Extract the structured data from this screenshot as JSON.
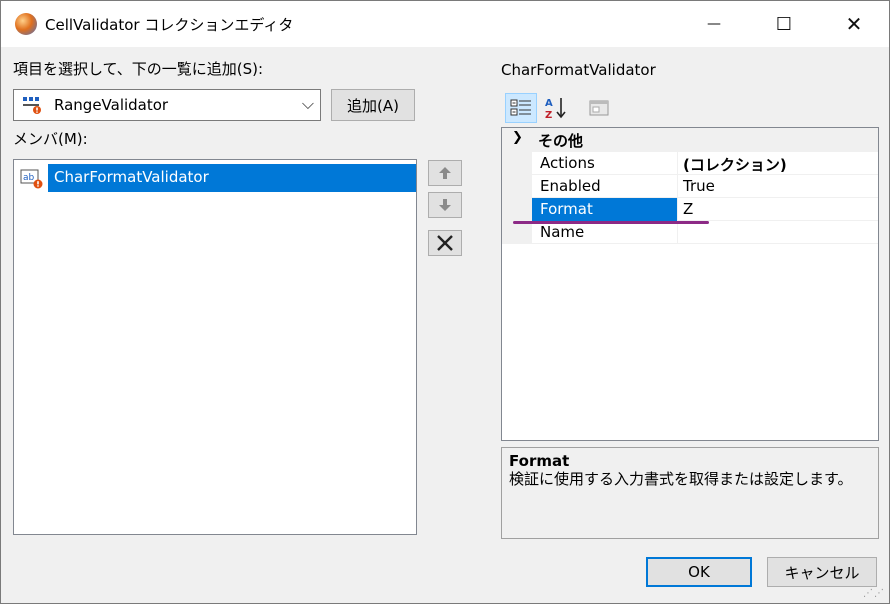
{
  "window": {
    "title": "CellValidator コレクションエディタ",
    "minimize_glyph": "—",
    "maximize_glyph": "☐",
    "close_glyph": "✕"
  },
  "add_section": {
    "label": "項目を選択して、下の一覧に追加(S):",
    "combo_value": "RangeValidator",
    "add_button": "追加(A)"
  },
  "members": {
    "label": "メンバ(M):",
    "items": [
      "CharFormatValidator"
    ],
    "move_up_icon": "arrow-up-icon",
    "move_down_icon": "arrow-down-icon",
    "delete_icon": "delete-x-icon"
  },
  "property_grid": {
    "object_name": "CharFormatValidator",
    "category": "その他",
    "rows": [
      {
        "name": "Actions",
        "value": "(コレクション)"
      },
      {
        "name": "Enabled",
        "value": "True"
      },
      {
        "name": "Format",
        "value": "Z"
      },
      {
        "name": "Name",
        "value": ""
      }
    ],
    "description_title": "Format",
    "description_text": "検証に使用する入力書式を取得または設定します。"
  },
  "buttons": {
    "ok": "OK",
    "cancel": "キャンセル"
  },
  "colors": {
    "selection": "#0078d7",
    "annotation_underline": "#8c2a86"
  }
}
